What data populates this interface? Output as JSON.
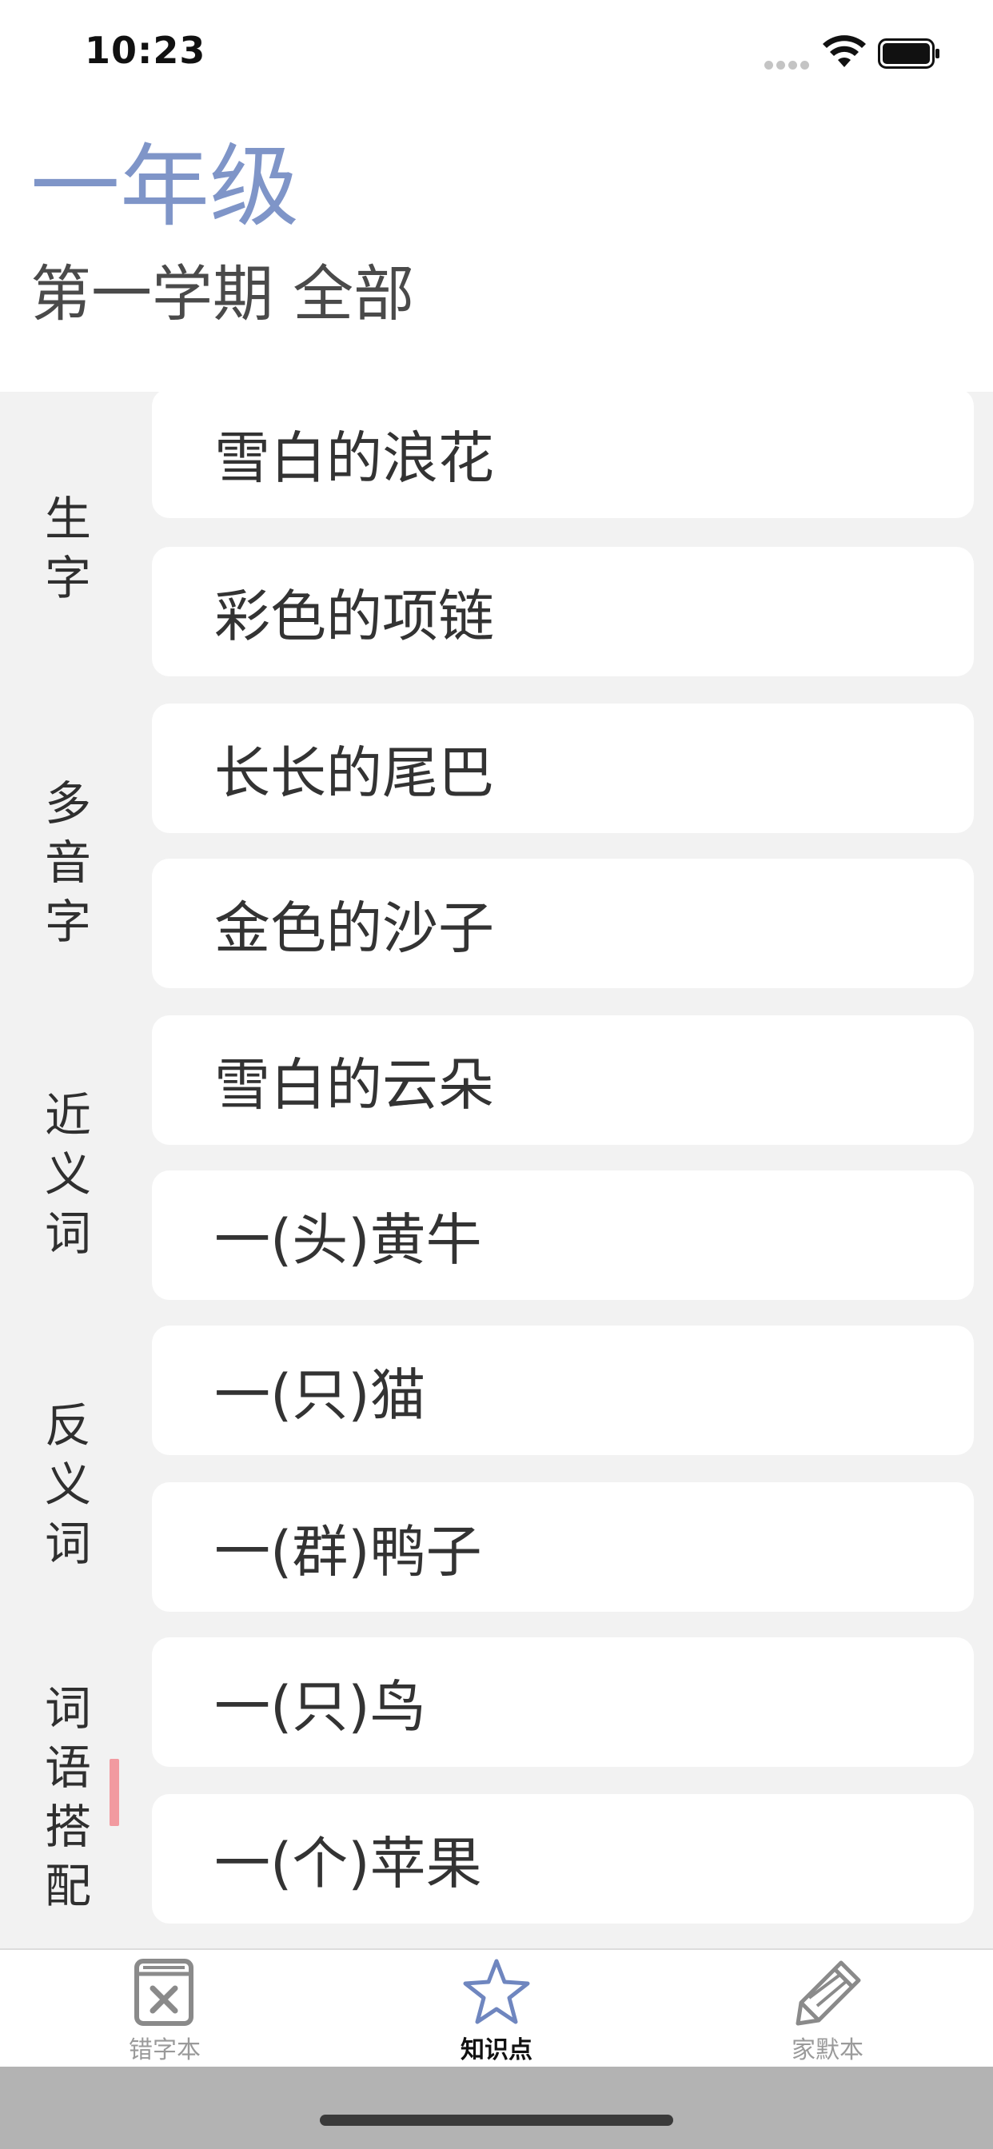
{
  "status_bar": {
    "time": "10:23"
  },
  "header": {
    "grade": "一年级",
    "term": "第一学期 全部"
  },
  "categories": [
    "生字",
    "多音字",
    "近义词",
    "反义词",
    "词语搭配"
  ],
  "items": [
    "雪白的浪花",
    "彩色的项链",
    "长长的尾巴",
    "金色的沙子",
    "雪白的云朵",
    "一(头)黄牛",
    "一(只)猫",
    "一(群)鸭子",
    "一(只)鸟",
    "一(个)苹果"
  ],
  "tabs": [
    {
      "label": "错字本",
      "icon": "error-book-icon",
      "active": false
    },
    {
      "label": "知识点",
      "icon": "star-icon",
      "active": true
    },
    {
      "label": "家默本",
      "icon": "pencil-icon",
      "active": false
    }
  ],
  "colors": {
    "grade_title": "#7f95c8",
    "index_indicator": "#f29aa0",
    "content_background": "#f2f2f2"
  }
}
